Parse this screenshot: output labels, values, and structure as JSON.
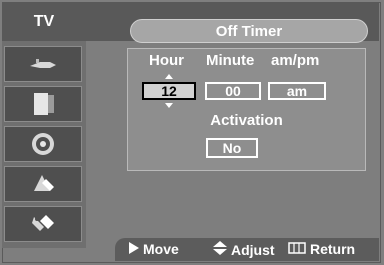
{
  "header": {
    "source_label": "TV",
    "title": "Off Timer"
  },
  "sidebar": {
    "items": [
      {
        "icon": "antenna-plug-icon"
      },
      {
        "icon": "tv-screen-icon"
      },
      {
        "icon": "speaker-icon"
      },
      {
        "icon": "settings-wrench-icon"
      },
      {
        "icon": "tools-icon"
      }
    ]
  },
  "timer": {
    "hour_label": "Hour",
    "minute_label": "Minute",
    "ampm_label": "am/pm",
    "hour_value": "12",
    "minute_value": "00",
    "ampm_value": "am",
    "activation_label": "Activation",
    "activation_value": "No"
  },
  "footer": {
    "move_label": "Move",
    "adjust_label": "Adjust",
    "return_label": "Return"
  }
}
